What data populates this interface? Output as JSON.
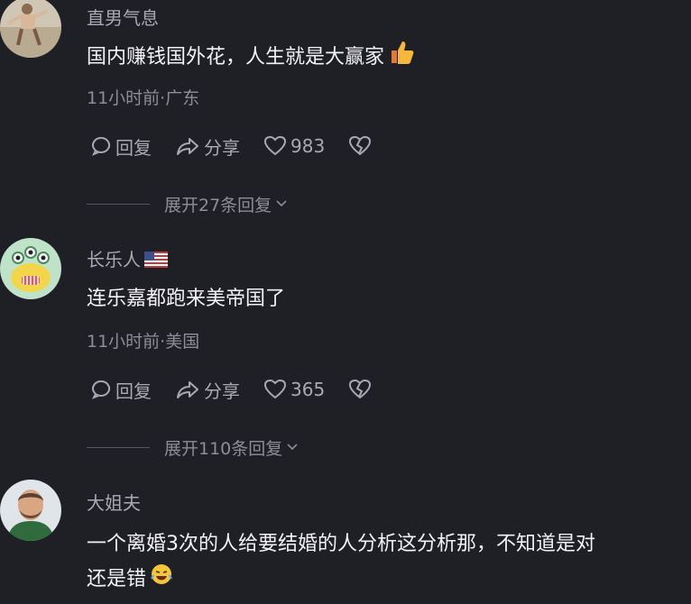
{
  "comments": [
    {
      "username": "直男气息",
      "content": "国内赚钱国外花，人生就是大赢家",
      "meta": "11小时前·广东",
      "reply_label": "回复",
      "share_label": "分享",
      "likes": "983",
      "expand_label": "展开27条回复"
    },
    {
      "username": "长乐人",
      "content": "连乐嘉都跑来美帝国了",
      "meta": "11小时前·美国",
      "reply_label": "回复",
      "share_label": "分享",
      "likes": "365",
      "expand_label": "展开110条回复"
    },
    {
      "username": "大姐夫",
      "content_line1": "一个离婚3次的人给要结婚的人分析这分析那，不知道是对",
      "content_line2": "还是错"
    }
  ],
  "icons": {
    "reply": "comment-bubble-icon",
    "share": "share-arrow-icon",
    "like": "heart-icon",
    "dislike": "broken-heart-icon",
    "thumbs_up": "thumbs-up-emoji",
    "laugh": "laughing-emoji",
    "flag": "us-flag-icon"
  },
  "colors": {
    "background": "#1f1f26",
    "text_primary": "#f2f2f5",
    "text_secondary": "#a9a9b2"
  }
}
